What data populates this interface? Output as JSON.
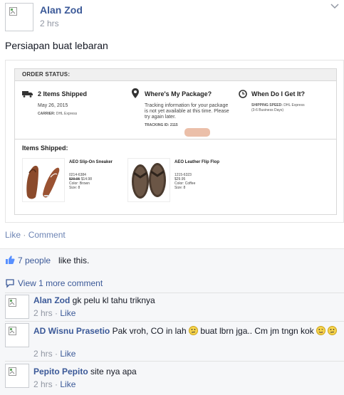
{
  "post": {
    "author": "Alan Zod",
    "time": "2 hrs",
    "text": "Persiapan buat lebaran"
  },
  "order": {
    "status_label": "ORDER STATUS:",
    "shipped": {
      "title": "2 Items Shipped",
      "date": "May 26, 2015",
      "carrier_label": "CARRIER:",
      "carrier_value": "DHL Express"
    },
    "where": {
      "title": "Where's My Package?",
      "line1": "Tracking information for your package",
      "line2": "is not yet available at this time. Please",
      "line3": "try again later.",
      "tracking_label": "TRACKING ID: 2115"
    },
    "when": {
      "title": "When Do I Get It?",
      "speed_label": "SHIPPING SPEED:",
      "speed_value": "DHL Express",
      "speed_days": "(3-6 Business Days)"
    },
    "items_title": "Items Shipped:",
    "items": [
      {
        "name": "AEO Slip-On Sneaker",
        "sku": "0214-6384",
        "old_price": "$29.95",
        "price": "$14.98",
        "color": "Color: Brown",
        "size": "Size: 8"
      },
      {
        "name": "AEO Leather Flip Flop",
        "sku": "1215-6323",
        "price": "$29.95",
        "color": "Color: Coffee",
        "size": "Size: 8"
      }
    ]
  },
  "actions": {
    "like": "Like",
    "separator": "·",
    "comment": "Comment"
  },
  "likes": {
    "count": "7 people",
    "text": "like this."
  },
  "view_more": "View 1 more comment",
  "comments": [
    {
      "name": "Alan Zod",
      "text": "gk pelu kl tahu triknya",
      "time": "2 hrs",
      "like": "Like"
    },
    {
      "name": "AD Wisnu Prasetio",
      "text_a": "Pak vroh, CO in lah",
      "text_b": "buat lbrn jga.. Cm jm tngn kok",
      "time": "2 hrs",
      "like": "Like"
    },
    {
      "name": "Pepito Pepito",
      "text": "site nya apa",
      "time": "2 hrs",
      "like": "Like"
    }
  ],
  "colors": {
    "link": "#3b5998",
    "muted": "#9197a3",
    "comment_bg": "#f6f7f9"
  }
}
